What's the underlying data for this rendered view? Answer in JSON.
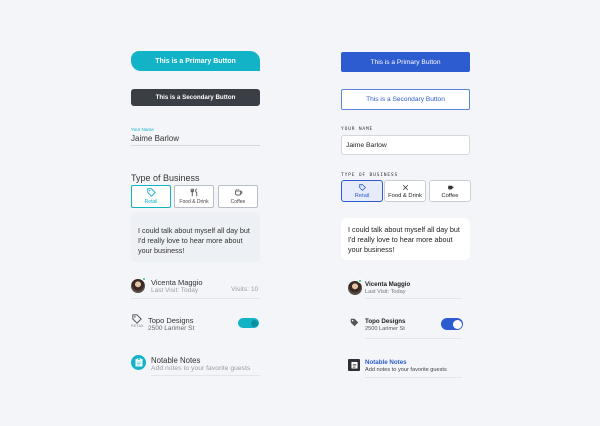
{
  "colors": {
    "teal_accent": "#12b3c7",
    "blue_accent": "#2d5bd0",
    "dark_button": "#3a3e45",
    "background": "#f3f5f9"
  },
  "left": {
    "primary_button": "This is a Primary Button",
    "secondary_button": "This is a Secondary Button",
    "name_field": {
      "label": "Your Name",
      "value": "Jaime Barlow"
    },
    "business": {
      "title": "Type of Business",
      "options": [
        {
          "label": "Retail",
          "icon": "tag-icon",
          "selected": true
        },
        {
          "label": "Food & Drink",
          "icon": "fork-knife-icon",
          "selected": false
        },
        {
          "label": "Coffee",
          "icon": "coffee-cup-icon",
          "selected": false
        }
      ]
    },
    "message": "I could talk about myself all day but I'd really love to hear more about your business!",
    "contact": {
      "name": "Vicenta Maggio",
      "sub": "Last Visit: Today",
      "visits": "Visits: 10"
    },
    "business_row": {
      "tag": "RETAIL",
      "name": "Topo Designs",
      "address": "2500 Larimer St",
      "toggle_on": true
    },
    "notes": {
      "title": "Notable Notes",
      "sub": "Add notes to your favorite guests"
    }
  },
  "right": {
    "primary_button": "This is a Primary Button",
    "secondary_button": "This is a Secondary Button",
    "name_field": {
      "label": "YOUR NAME",
      "value": "Jaime Barlow"
    },
    "business": {
      "title": "TYPE OF BUSINESS",
      "options": [
        {
          "label": "Retail",
          "icon": "tag-icon",
          "selected": true
        },
        {
          "label": "Food & Drink",
          "icon": "fork-knife-icon",
          "selected": false
        },
        {
          "label": "Coffee",
          "icon": "coffee-cup-icon",
          "selected": false
        }
      ]
    },
    "message": "I could talk about myself all day but I'd really love to hear more about your business!",
    "contact": {
      "name": "Vicenta Maggio",
      "sub": "Last Visit: Today"
    },
    "business_row": {
      "name": "Topo Designs",
      "address": "2500 Larimer St",
      "toggle_on": true
    },
    "notes": {
      "title": "Notable Notes",
      "sub": "Add notes to your favorite guests"
    }
  }
}
